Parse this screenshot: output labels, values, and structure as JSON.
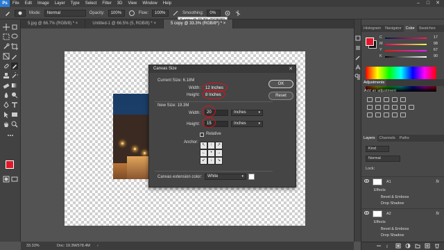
{
  "app": {
    "logo": "Ps",
    "menus": [
      "File",
      "Edit",
      "Image",
      "Layer",
      "Type",
      "Select",
      "Filter",
      "3D",
      "View",
      "Window",
      "Help"
    ],
    "window_controls": [
      "–",
      "□",
      "✕"
    ]
  },
  "options_bar": {
    "mode_label": "Mode:",
    "mode_value": "Normal",
    "opacity_label": "Opacity:",
    "opacity_value": "100%",
    "flow_label": "Flow:",
    "flow_value": "100%",
    "smoothing_label": "Smoothing:",
    "smoothing_value": "0%",
    "tooltip": "5 copy @ 33.3% (RGB/8*)"
  },
  "tabs": [
    {
      "label": "5.jpg @ 66.7% (RGB/8) *",
      "close": "×",
      "active": false
    },
    {
      "label": "Untitled-1 @ 66.5% (5, RGB/8) *",
      "close": "×",
      "active": false
    },
    {
      "label": "5 copy @ 33.3% (RGB/8*) *",
      "close": "×",
      "active": true
    }
  ],
  "status_bar": {
    "zoom": "33.33%",
    "doc_info": "Doc: 19.3M/578.4M",
    "arrow": "›"
  },
  "dialog": {
    "title": "Canvas Size",
    "close": "✕",
    "current_size_label": "Current Size: 6.18M",
    "current_width_label": "Width:",
    "current_width_value": "12 Inches",
    "current_height_label": "Height:",
    "current_height_value": "8 Inches",
    "new_size_label": "New Size: 19.3M",
    "width_label": "Width:",
    "width_value": "20",
    "width_unit": "Inches",
    "height_label": "Height:",
    "height_value": "15",
    "height_unit": "Inches",
    "relative_label": "Relative",
    "relative_checked": false,
    "anchor_label": "Anchor:",
    "anchor_arrows": [
      "↖",
      "↑",
      "↗",
      "←",
      "•",
      "→",
      "↙",
      "↓",
      "↘"
    ],
    "extension_color_label": "Canvas extension color:",
    "extension_color_value": "White",
    "extension_color_hex": "#ffffff",
    "ok_label": "OK",
    "reset_label": "Reset",
    "dropdown_caret": "▾"
  },
  "color_panel": {
    "tabs": [
      "Histogram",
      "Navigator",
      "Color",
      "Swatches"
    ],
    "active_tab": "Color",
    "channels": [
      {
        "label": "C",
        "value": "17"
      },
      {
        "label": "M",
        "value": "98"
      },
      {
        "label": "Y",
        "value": "67"
      },
      {
        "label": "K",
        "value": "90"
      }
    ],
    "foreground": "#e0182a",
    "background": "#111111"
  },
  "adjustments_panel": {
    "title": "Adjustments",
    "subtitle": "Add an adjustment"
  },
  "layers_panel": {
    "tabs": [
      "Layers",
      "Channels",
      "Paths"
    ],
    "active_tab": "Layers",
    "filter_label": "Kind",
    "blend_mode": "Normal",
    "lock_label": "Lock:",
    "layers": [
      {
        "name": "A1",
        "effects_label": "Effects",
        "effects": [
          "Bevel & Emboss",
          "Drop Shadow"
        ]
      },
      {
        "name": "A2",
        "effects_label": "Effects",
        "effects": [
          "Bevel & Emboss",
          "Drop Shadow"
        ]
      }
    ],
    "fx_label": "fx"
  }
}
